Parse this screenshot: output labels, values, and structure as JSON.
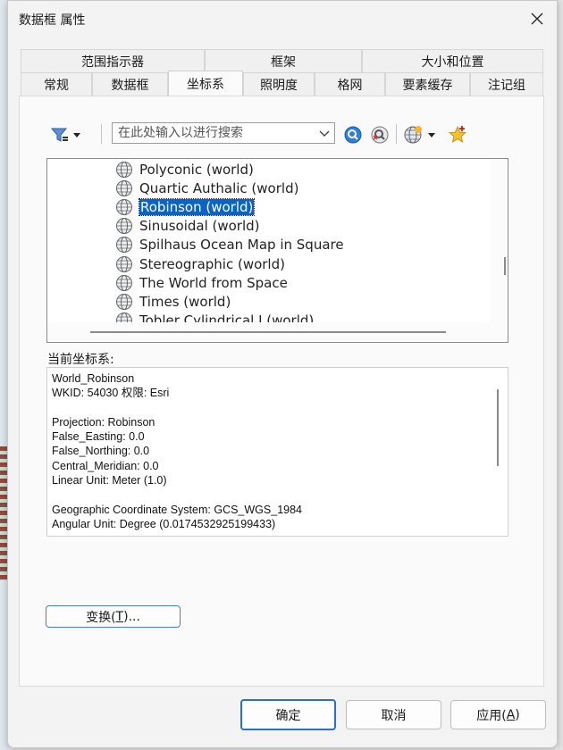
{
  "window": {
    "title": "数据框 属性"
  },
  "tabs": {
    "row1": [
      {
        "label": "范围指示器"
      },
      {
        "label": "框架"
      },
      {
        "label": "大小和位置"
      }
    ],
    "row2": [
      {
        "label": "常规"
      },
      {
        "label": "数据框"
      },
      {
        "label": "坐标系"
      },
      {
        "label": "照明度"
      },
      {
        "label": "格网"
      },
      {
        "label": "要素缓存"
      },
      {
        "label": "注记组"
      }
    ],
    "active": "坐标系"
  },
  "toolbar": {
    "filter_icon": "filter-icon",
    "search_placeholder": "在此处输入以进行搜索",
    "search_value": "",
    "icons": [
      "search-icon",
      "clear-search-icon",
      "globe-icon",
      "add-favorite-icon"
    ]
  },
  "projection_list": {
    "items": [
      {
        "label": "Polyconic (world)"
      },
      {
        "label": "Quartic Authalic (world)"
      },
      {
        "label": "Robinson (world)"
      },
      {
        "label": "Sinusoidal (world)"
      },
      {
        "label": "Spilhaus Ocean Map in Square"
      },
      {
        "label": "Stereographic (world)"
      },
      {
        "label": "The World from Space"
      },
      {
        "label": "Times (world)"
      },
      {
        "label": "Tobler Cylindrical I (world)"
      }
    ],
    "selected": "Robinson (world)"
  },
  "current_cs": {
    "label": "当前坐标系:",
    "details": "World_Robinson\nWKID: 54030 权限: Esri\n\nProjection: Robinson\nFalse_Easting: 0.0\nFalse_Northing: 0.0\nCentral_Meridian: 0.0\nLinear Unit: Meter (1.0)\n\nGeographic Coordinate System: GCS_WGS_1984\nAngular Unit: Degree (0.0174532925199433)"
  },
  "buttons": {
    "transform": {
      "text": "变换(",
      "key": "T",
      "suffix": ")..."
    },
    "ok": "确定",
    "cancel": "取消",
    "apply": {
      "text": "应用(",
      "key": "A",
      "suffix": ")"
    }
  }
}
